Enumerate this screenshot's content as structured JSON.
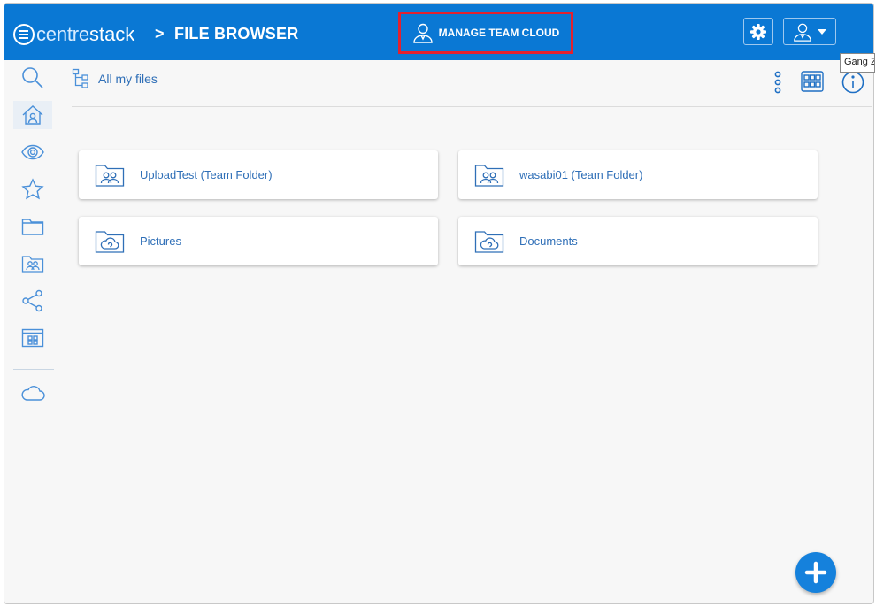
{
  "brand": {
    "part1": "centre",
    "part2": "stack"
  },
  "header": {
    "separator": ">",
    "title": "FILE BROWSER",
    "manage_label": "MANAGE TEAM CLOUD"
  },
  "tooltip": {
    "text": "Gang Z"
  },
  "sidebar": {
    "items": [
      {
        "icon": "search-icon"
      },
      {
        "icon": "home-icon",
        "active": true
      },
      {
        "icon": "eye-icon"
      },
      {
        "icon": "star-icon"
      },
      {
        "icon": "folder-icon"
      },
      {
        "icon": "team-folder-icon"
      },
      {
        "icon": "share-icon"
      },
      {
        "icon": "apps-icon"
      },
      {
        "icon": "cloud-icon"
      }
    ]
  },
  "breadcrumb": {
    "label": "All my files"
  },
  "files": [
    {
      "name": "UploadTest (Team Folder)",
      "icon": "team-folder-icon"
    },
    {
      "name": "wasabi01 (Team Folder)",
      "icon": "team-folder-icon"
    },
    {
      "name": "Pictures",
      "icon": "cloud-folder-icon"
    },
    {
      "name": "Documents",
      "icon": "cloud-folder-icon"
    }
  ],
  "colors": {
    "header": "#0a78d4",
    "accent": "#2f6fb7",
    "highlight": "#e3212f",
    "fab": "#1581dc"
  }
}
